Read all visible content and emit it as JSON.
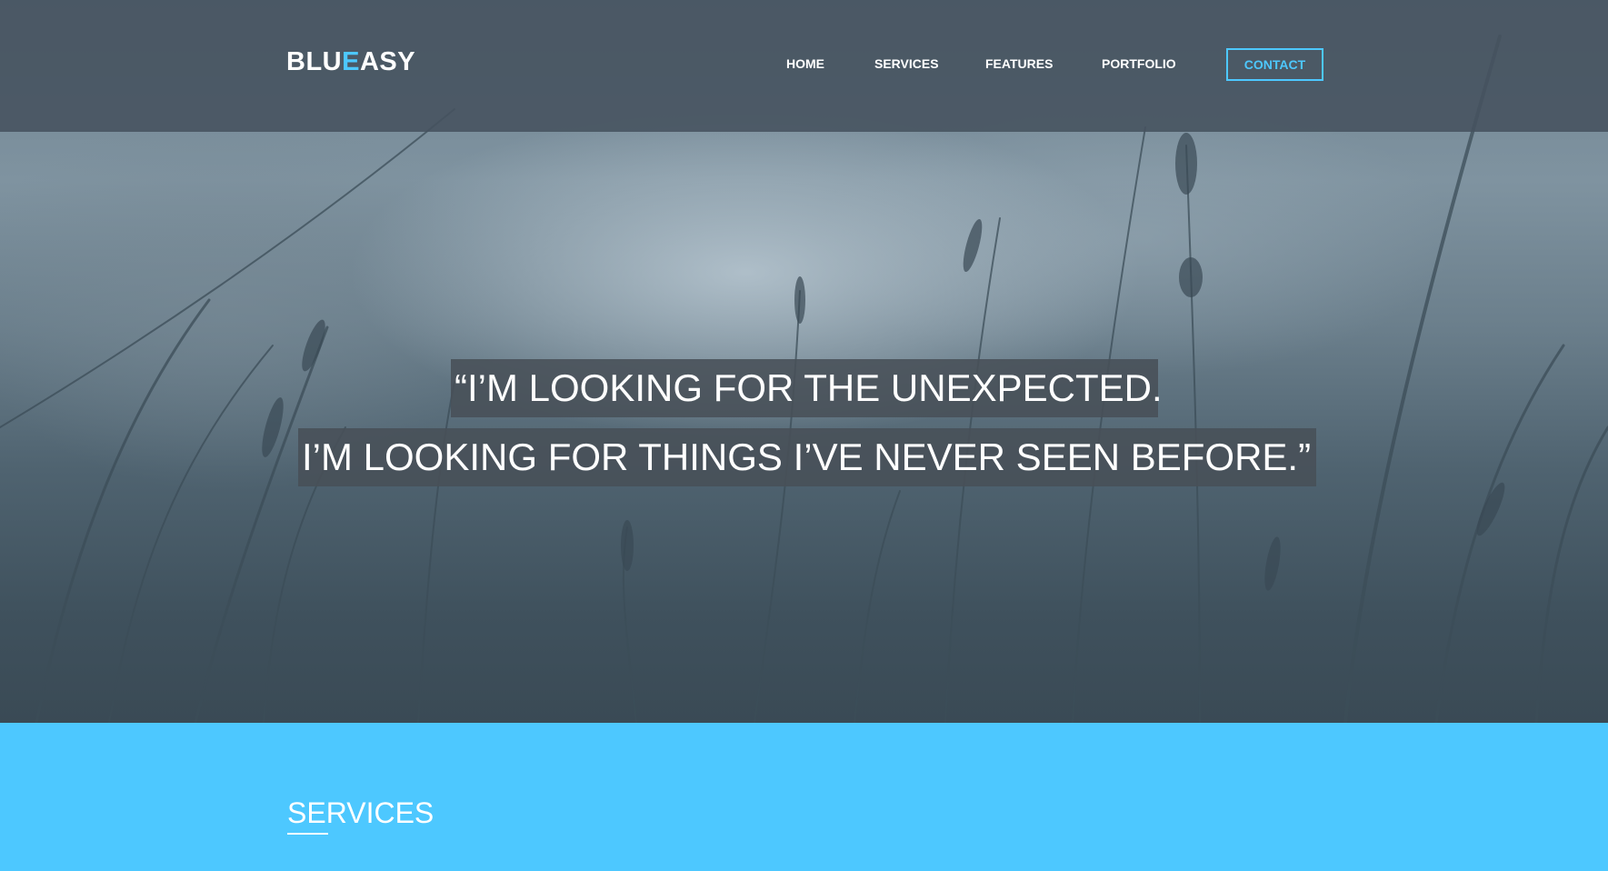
{
  "brand": {
    "logo_part1": "BLU",
    "logo_accent": "E",
    "logo_part2": "ASY",
    "accent_color": "#4dc8ff"
  },
  "nav": {
    "items": [
      {
        "label": "HOME"
      },
      {
        "label": "SERVICES"
      },
      {
        "label": "FEATURES"
      },
      {
        "label": "PORTFOLIO"
      }
    ],
    "contact_label": "CONTACT"
  },
  "hero": {
    "quote_line1": "“I’M LOOKING FOR THE UNEXPECTED.",
    "quote_line2": "I’M LOOKING FOR THINGS I’VE NEVER SEEN BEFORE.”"
  },
  "services": {
    "title": "SERVICES",
    "background_color": "#4dc8ff"
  }
}
